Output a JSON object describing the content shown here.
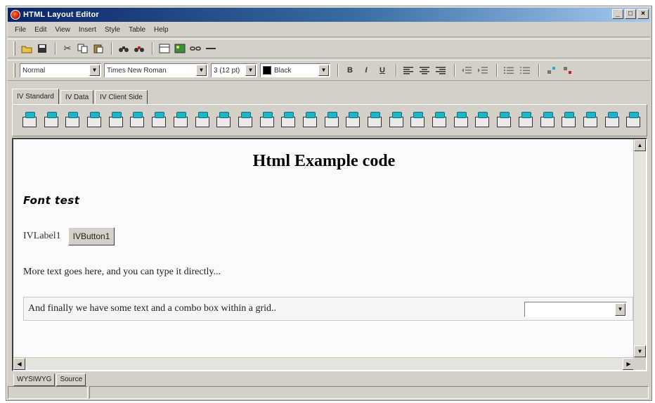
{
  "window": {
    "title": "HTML Layout Editor"
  },
  "title_buttons": {
    "minimize": "_",
    "maximize": "□",
    "close": "×"
  },
  "menu": [
    "File",
    "Edit",
    "View",
    "Insert",
    "Style",
    "Table",
    "Help"
  ],
  "toolbar": {
    "icons": [
      "open-icon",
      "save-icon",
      "cut-icon",
      "copy-icon",
      "paste-icon",
      "find-icon",
      "replace-icon",
      "table-icon",
      "image-icon",
      "link-icon",
      "horizontal-rule-icon"
    ]
  },
  "format_bar": {
    "paragraph_style": "Normal",
    "font_face": "Times New Roman",
    "font_size": "3 (12 pt)",
    "color_name": "Black",
    "color_hex": "#000000",
    "bold": "B",
    "italic": "I",
    "underline": "U"
  },
  "tabs": [
    "IV Standard",
    "IV Data",
    "IV Client Side"
  ],
  "palette_count": 29,
  "editor": {
    "heading": "Html Example code",
    "font_text": "Font test",
    "label_text": "IVLabel1",
    "button_text": "IVButton1",
    "more_text": "More text goes here, and you can type it directly...",
    "grid_text": "And finally we have some text and a combo box within a grid..",
    "grid_combo_value": ""
  },
  "bottom_tabs": [
    "WYSIWYG",
    "Source"
  ],
  "colors": {
    "title_start": "#0a246a",
    "title_end": "#a6caf0",
    "chrome": "#d4d0c8",
    "palette_accent": "#1fb5c8"
  }
}
